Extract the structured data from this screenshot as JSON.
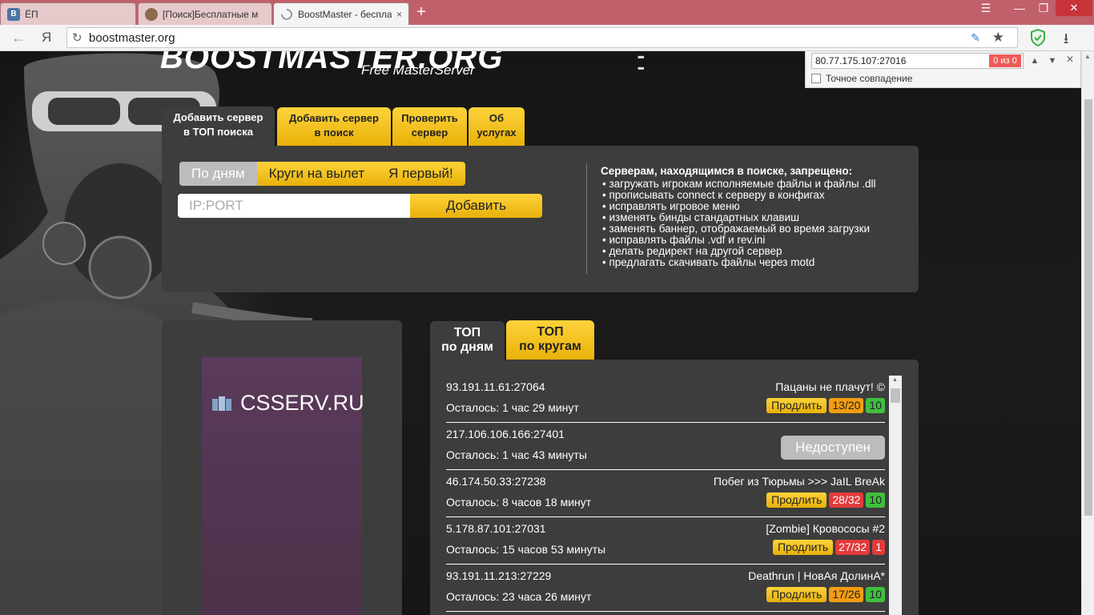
{
  "browser": {
    "tabs": [
      {
        "label": "ЁП",
        "icon": "vk-icon",
        "active": false
      },
      {
        "label": "[Поиск]Бесплатные м",
        "icon": "avatar-icon",
        "active": false
      },
      {
        "label": "BoostMaster - бесплат",
        "icon": "loading-icon",
        "active": true
      }
    ],
    "yandex_label": "Я",
    "url": "boostmaster.org"
  },
  "find": {
    "query": "80.77.175.107:27016",
    "count": "0 из 0",
    "exact_label": "Точное совпадение"
  },
  "site": {
    "logo": "BOOSTMASTER.ORG",
    "subtitle": "Free MasterServer"
  },
  "top_tabs": [
    {
      "line1": "Добавить сервер",
      "line2": "в ТОП поиска"
    },
    {
      "line1": "Добавить сервер",
      "line2": "в поиск"
    },
    {
      "line1": "Проверить",
      "line2": "сервер"
    },
    {
      "line1": "Об",
      "line2": "услугах"
    }
  ],
  "form": {
    "modes": [
      "По дням",
      "Круги на вылет",
      "Я первый!"
    ],
    "ip_placeholder": "IP:PORT",
    "add_label": "Добавить"
  },
  "rules": {
    "title": "Серверам, находящимся в поиске, запрещено:",
    "items": [
      "загружать игрокам исполняемые файлы и файлы .dll",
      "прописывать connect к серверу в конфигах",
      "исправлять игровое меню",
      "изменять бинды стандартных клавиш",
      "заменять баннер, отображаемый во время загрузки",
      "исправлять файлы .vdf и rev.ini",
      "делать редирект на другой сервер",
      "предлагать скачивать файлы через motd"
    ]
  },
  "ad": {
    "text": "CSSERV.RU"
  },
  "list_tabs": [
    {
      "line1": "ТОП",
      "line2": "по дням"
    },
    {
      "line1": "ТОП",
      "line2": "по кругам"
    }
  ],
  "prolong_label": "Продлить",
  "unavailable_label": "Недоступен",
  "servers": [
    {
      "ip": "93.191.11.61:27064",
      "left": "Осталось: 1 час 29 минут",
      "name": "Пацаны не плачут! ©",
      "players": "13/20",
      "players_color": "orange",
      "rank": "10",
      "rank_color": "green"
    },
    {
      "ip": "217.106.106.166:27401",
      "left": "Осталось: 1 час 43 минуты",
      "name": "",
      "players": "",
      "rank": "",
      "unavailable": true
    },
    {
      "ip": "46.174.50.33:27238",
      "left": "Осталось: 8 часов 18 минут",
      "name": "Побег из Тюрьмы >>> JaIL BreAk",
      "players": "28/32",
      "players_color": "red",
      "rank": "10",
      "rank_color": "green"
    },
    {
      "ip": "5.178.87.101:27031",
      "left": "Осталось: 15 часов 53 минуты",
      "name": "[Zombie] Кровососы #2",
      "players": "27/32",
      "players_color": "red",
      "rank": "1",
      "rank_color": "red"
    },
    {
      "ip": "93.191.11.213:27229",
      "left": "Осталось: 23 часа 26 минут",
      "name": "Deathrun | НовАя ДолинА*",
      "players": "17/26",
      "players_color": "orange",
      "rank": "10",
      "rank_color": "green"
    }
  ]
}
